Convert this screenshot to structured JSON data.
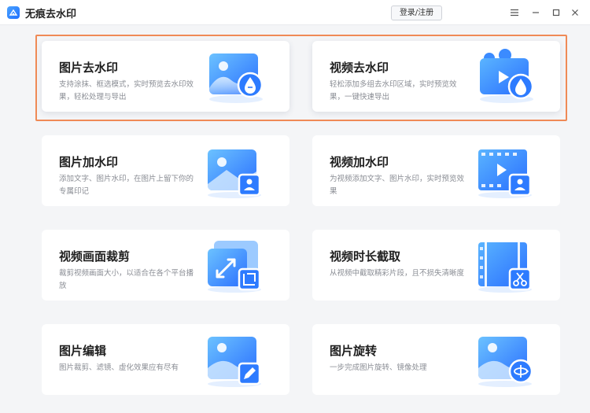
{
  "app": {
    "title": "无痕去水印",
    "login_label": "登录/注册",
    "accent": "#2a7bff",
    "highlight_color": "#ef8a56"
  },
  "window_controls": [
    "menu-icon",
    "minimize-icon",
    "maximize-icon",
    "close-icon"
  ],
  "features": [
    {
      "title": "图片去水印",
      "desc": "支持涂抹、框选模式，实时预览去水印效果，轻松处理与导出",
      "icon": "image-remove-watermark-icon",
      "highlighted": true
    },
    {
      "title": "视频去水印",
      "desc": "轻松添加多组去水印区域，实时预览效果，一键快速导出",
      "icon": "video-remove-watermark-icon",
      "highlighted": true
    },
    {
      "title": "图片加水印",
      "desc": "添加文字、图片水印，在图片上留下你的专属印记",
      "icon": "image-add-watermark-icon",
      "highlighted": false
    },
    {
      "title": "视频加水印",
      "desc": "为视频添加文字、图片水印，实时预览效果",
      "icon": "video-add-watermark-icon",
      "highlighted": false
    },
    {
      "title": "视频画面裁剪",
      "desc": "裁剪视频画面大小，以适合在各个平台播放",
      "icon": "video-crop-icon",
      "highlighted": false
    },
    {
      "title": "视频时长截取",
      "desc": "从视频中截取精彩片段，且不损失清晰度",
      "icon": "video-trim-icon",
      "highlighted": false
    },
    {
      "title": "图片编辑",
      "desc": "图片裁剪、滤镜、虚化效果应有尽有",
      "icon": "image-edit-icon",
      "highlighted": false
    },
    {
      "title": "图片旋转",
      "desc": "一步完成图片旋转、镜像处理",
      "icon": "image-rotate-icon",
      "highlighted": false
    }
  ]
}
